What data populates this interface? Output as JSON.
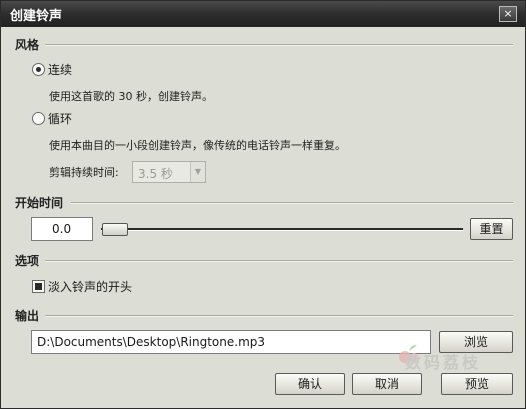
{
  "window": {
    "title": "创建铃声",
    "close_glyph": "×"
  },
  "style_section": {
    "title": "风格",
    "options": [
      {
        "label": "连续",
        "description": "使用这首歌的 30 秒，创建铃声。",
        "selected": true
      },
      {
        "label": "循环",
        "description": "使用本曲目的一小段创建铃声，像传统的电话铃声一样重复。",
        "selected": false
      }
    ],
    "clip_duration": {
      "label": "剪辑持续时间:",
      "value": "3.5 秒"
    }
  },
  "start_time_section": {
    "title": "开始时间",
    "value": "0.0",
    "slider_position": 0,
    "reset_label": "重置"
  },
  "options_section": {
    "title": "选项",
    "fade_in": {
      "label": "淡入铃声的开头",
      "checked": true
    }
  },
  "output_section": {
    "title": "输出",
    "path": "D:\\Documents\\Desktop\\Ringtone.mp3",
    "browse_label": "浏览"
  },
  "footer": {
    "ok_label": "确认",
    "cancel_label": "取消",
    "preview_label": "预览"
  },
  "watermark": {
    "text": "数码荔枝"
  }
}
